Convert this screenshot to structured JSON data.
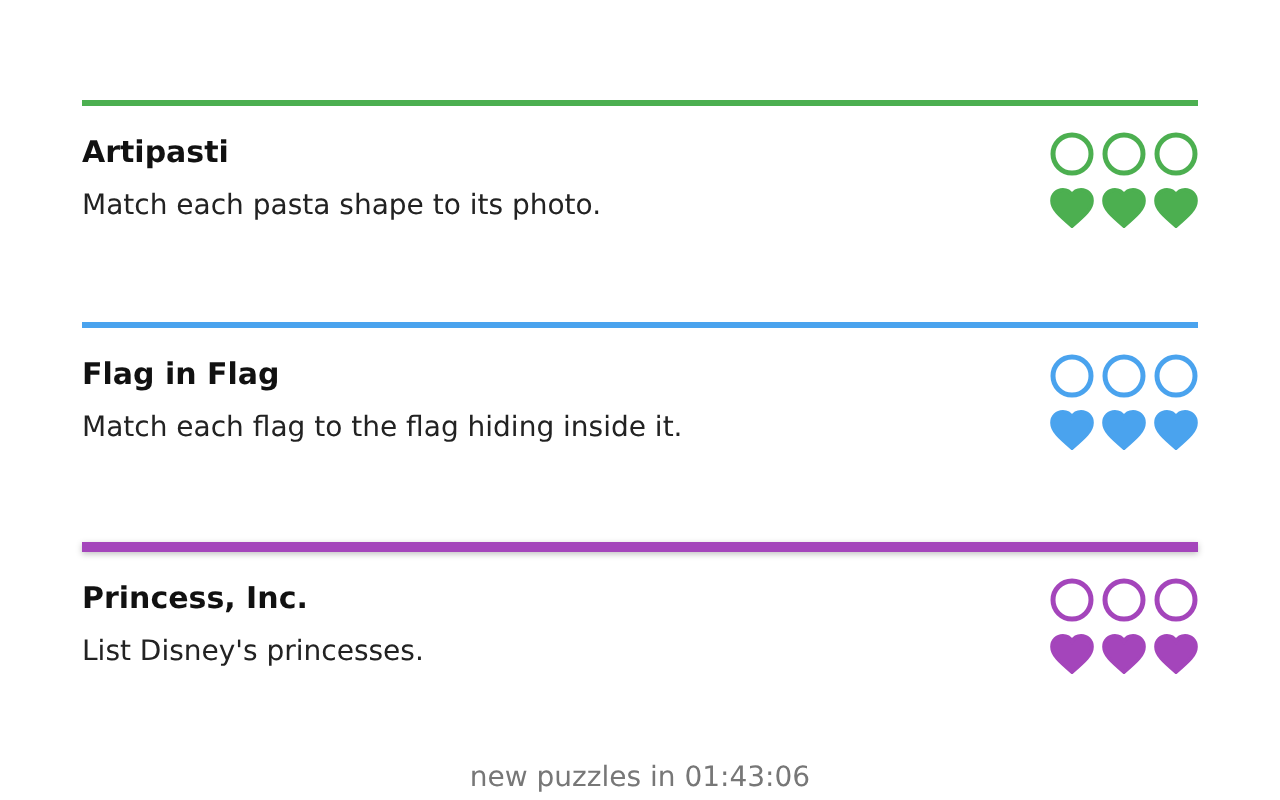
{
  "puzzles": [
    {
      "title": "Artipasti",
      "description": "Match each pasta shape to its photo.",
      "color": "#4caf50",
      "thick": false,
      "circles": [
        {
          "done": false
        },
        {
          "done": false
        },
        {
          "done": false
        }
      ],
      "hearts": [
        {
          "filled": true
        },
        {
          "filled": true
        },
        {
          "filled": true
        }
      ]
    },
    {
      "title": "Flag in Flag",
      "description": "Match each flag to the flag hiding inside it.",
      "color": "#4aa3ee",
      "thick": false,
      "circles": [
        {
          "done": false
        },
        {
          "done": false
        },
        {
          "done": false
        }
      ],
      "hearts": [
        {
          "filled": true
        },
        {
          "filled": true
        },
        {
          "filled": true
        }
      ]
    },
    {
      "title": "Princess, Inc.",
      "description": "List Disney's princesses.",
      "color": "#a445bb",
      "thick": true,
      "circles": [
        {
          "done": false
        },
        {
          "done": false
        },
        {
          "done": false
        }
      ],
      "hearts": [
        {
          "filled": true
        },
        {
          "filled": true
        },
        {
          "filled": true
        }
      ]
    }
  ],
  "footer": "new puzzles in 01:43:06"
}
